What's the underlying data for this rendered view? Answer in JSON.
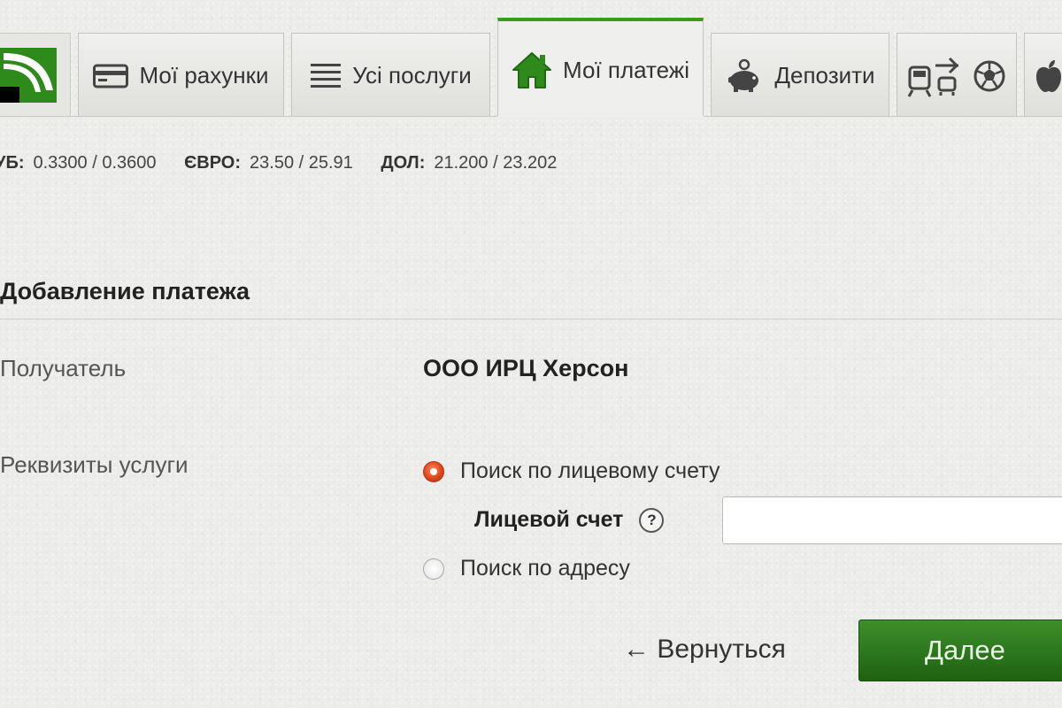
{
  "tabs": [
    {
      "label": "Мої рахунки",
      "icon": "card-icon"
    },
    {
      "label": "Усі послуги",
      "icon": "list-icon"
    },
    {
      "label": "Мої платежі",
      "icon": "house-icon",
      "active": true
    },
    {
      "label": "Депозити",
      "icon": "piggy-bank-icon"
    },
    {
      "label": "",
      "icon": "train-plane-icon"
    },
    {
      "label": "",
      "icon": "apple-icon"
    }
  ],
  "rates": [
    {
      "label": "УБ:",
      "value": "0.3300 / 0.3600"
    },
    {
      "label": "ЄВРО:",
      "value": "23.50 / 25.91"
    },
    {
      "label": "ДОЛ:",
      "value": "21.200 / 23.202"
    }
  ],
  "form": {
    "title": "Добавление платежа",
    "recipient_label": "Получатель",
    "recipient_value": "ООО ИРЦ Херсон",
    "requisites_label": "Реквизиты услуги",
    "search_account": "Поиск по лицевому счету",
    "account_label": "Лицевой счет",
    "help": "?",
    "account_value": "",
    "search_address": "Поиск по адресу",
    "back": "← Вернуться",
    "next": "Далее"
  },
  "colors": {
    "brand_green": "#2f8a1c",
    "active_tab_border": "#3a9a1f",
    "radio_selected": "#e0451a",
    "button_green": "#1e6112"
  }
}
